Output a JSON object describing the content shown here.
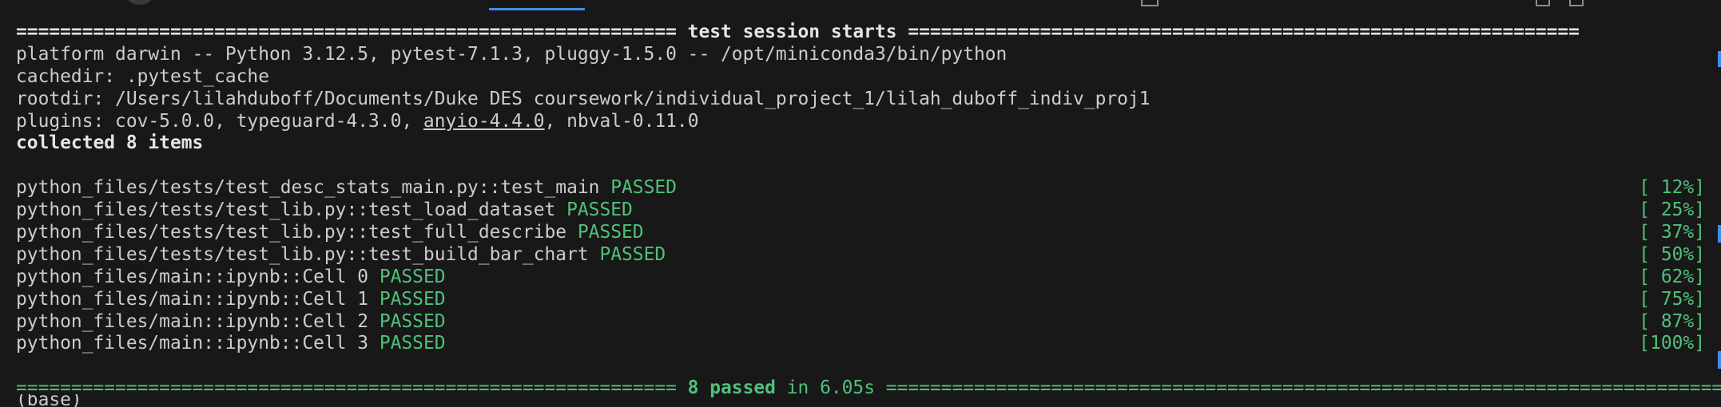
{
  "header_separator": "============================================================ test session starts =============================================================",
  "platform_line": "platform darwin -- Python 3.12.5, pytest-7.1.3, pluggy-1.5.0 -- /opt/miniconda3/bin/python",
  "cachedir_line": "cachedir: .pytest_cache",
  "rootdir_line": "rootdir: /Users/lilahduboff/Documents/Duke DES coursework/individual_project_1/lilah_duboff_indiv_proj1",
  "plugins": {
    "prefix": "plugins: cov-5.0.0, typeguard-4.3.0, ",
    "underlined": "anyio-4.4.0",
    "suffix": ", nbval-0.11.0"
  },
  "collected_line": "collected 8 items",
  "tests": [
    {
      "name": "python_files/tests/test_desc_stats_main.py::test_main",
      "status": "PASSED",
      "progress": "[ 12%]"
    },
    {
      "name": "python_files/tests/test_lib.py::test_load_dataset",
      "status": "PASSED",
      "progress": "[ 25%]"
    },
    {
      "name": "python_files/tests/test_lib.py::test_full_describe",
      "status": "PASSED",
      "progress": "[ 37%]"
    },
    {
      "name": "python_files/tests/test_lib.py::test_build_bar_chart",
      "status": "PASSED",
      "progress": "[ 50%]"
    },
    {
      "name": "python_files/main::ipynb::Cell 0",
      "status": "PASSED",
      "progress": "[ 62%]"
    },
    {
      "name": "python_files/main::ipynb::Cell 1",
      "status": "PASSED",
      "progress": "[ 75%]"
    },
    {
      "name": "python_files/main::ipynb::Cell 2",
      "status": "PASSED",
      "progress": "[ 87%]"
    },
    {
      "name": "python_files/main::ipynb::Cell 3",
      "status": "PASSED",
      "progress": "[100%]"
    }
  ],
  "summary": {
    "left_sep": "============================================================ ",
    "passed": "8 passed",
    "time": " in 6.05s ",
    "right_sep": "=============================================================================="
  },
  "colors": {
    "background": "#181818",
    "text": "#cccccc",
    "passed_green": "#4fc27a",
    "accent_blue": "#3b8eea"
  }
}
